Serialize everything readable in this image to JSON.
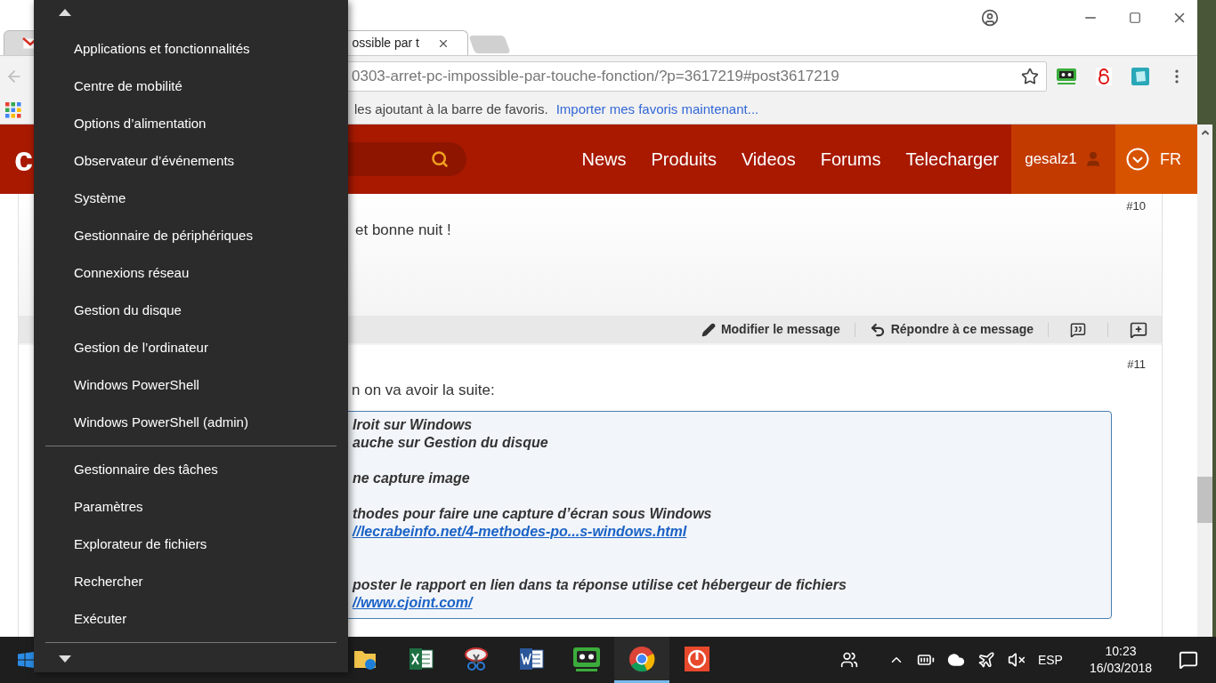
{
  "browser": {
    "tabs": [
      {
        "kind": "mail",
        "selected": false
      },
      {
        "kind": "page",
        "label": "ossible par t",
        "selected": true
      }
    ],
    "url": "0303-arret-pc-impossible-par-touche-fonction/?p=3617219#post3617219",
    "bookmarks": {
      "hint": "les ajoutant à la barre de favoris.",
      "link": "Importer mes favoris maintenant..."
    }
  },
  "site": {
    "logo": "c",
    "nav": [
      "News",
      "Produits",
      "Videos",
      "Forums",
      "Telecharger"
    ],
    "user": "gesalz1",
    "language": "FR"
  },
  "posts": [
    {
      "number": "#10",
      "text": "et bonne nuit !",
      "actions": [
        "Modifier le message",
        "Répondre à ce message"
      ]
    },
    {
      "number": "#11",
      "text": "n on va avoir la suite:",
      "quote": [
        {
          "kind": "text",
          "text": "lroit sur Windows"
        },
        {
          "kind": "text",
          "text": "auche sur Gestion du disque"
        },
        {
          "kind": "blank"
        },
        {
          "kind": "text",
          "text": "ne capture image"
        },
        {
          "kind": "blank"
        },
        {
          "kind": "text",
          "text": "thodes pour faire une capture d’écran sous Windows"
        },
        {
          "kind": "link",
          "text": "//lecrabeinfo.net/4-methodes-po...s-windows.html"
        },
        {
          "kind": "blank"
        },
        {
          "kind": "blank"
        },
        {
          "kind": "text",
          "text": "poster le rapport en lien dans ta réponse utilise cet hébergeur de fichiers"
        },
        {
          "kind": "link",
          "text": "//www.cjoint.com/"
        }
      ]
    }
  ],
  "menu": {
    "groups": [
      [
        "Applications et fonctionnalités",
        "Centre de mobilité",
        "Options d’alimentation",
        "Observateur d’événements",
        "Système",
        "Gestionnaire de périphériques",
        "Connexions réseau",
        "Gestion du disque",
        "Gestion de l’ordinateur",
        "Windows PowerShell",
        "Windows PowerShell (admin)"
      ],
      [
        "Gestionnaire des tâches",
        "Paramètres",
        "Explorateur de fichiers",
        "Rechercher",
        "Exécuter"
      ]
    ]
  },
  "taskbar": {
    "apps": [
      {
        "kind": "explorer",
        "selected": false
      },
      {
        "kind": "excel",
        "selected": false
      },
      {
        "kind": "snip",
        "selected": false
      },
      {
        "kind": "word",
        "selected": false
      },
      {
        "kind": "vault",
        "selected": false
      },
      {
        "kind": "chrome",
        "selected": true
      },
      {
        "kind": "power",
        "selected": false
      }
    ],
    "language": "ESP",
    "time": "10:23",
    "date": "16/03/2018"
  }
}
